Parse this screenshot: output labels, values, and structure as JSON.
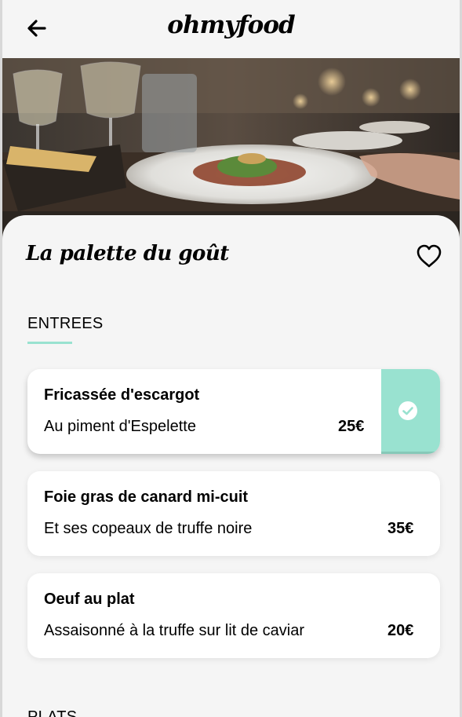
{
  "header": {
    "logo": "ohmyfood"
  },
  "restaurant": {
    "name": "La palette du goût"
  },
  "sections": [
    {
      "title": "ENTREES",
      "dishes": [
        {
          "name": "Fricassée d'escargot",
          "description": "Au piment d'Espelette",
          "price": "25€",
          "selected": true
        },
        {
          "name": "Foie gras de canard mi-cuit",
          "description": "Et ses copeaux de truffe noire",
          "price": "35€",
          "selected": false
        },
        {
          "name": "Oeuf au plat",
          "description": "Assaisonné à la truffe sur lit de caviar",
          "price": "20€",
          "selected": false
        }
      ]
    },
    {
      "title": "PLATS"
    }
  ],
  "colors": {
    "accent": "#99e2d0",
    "background": "#f5f5f5",
    "card": "#ffffff"
  },
  "icons": {
    "back": "arrow-left-icon",
    "favorite": "heart-outline-icon",
    "selected": "check-circle-icon"
  }
}
